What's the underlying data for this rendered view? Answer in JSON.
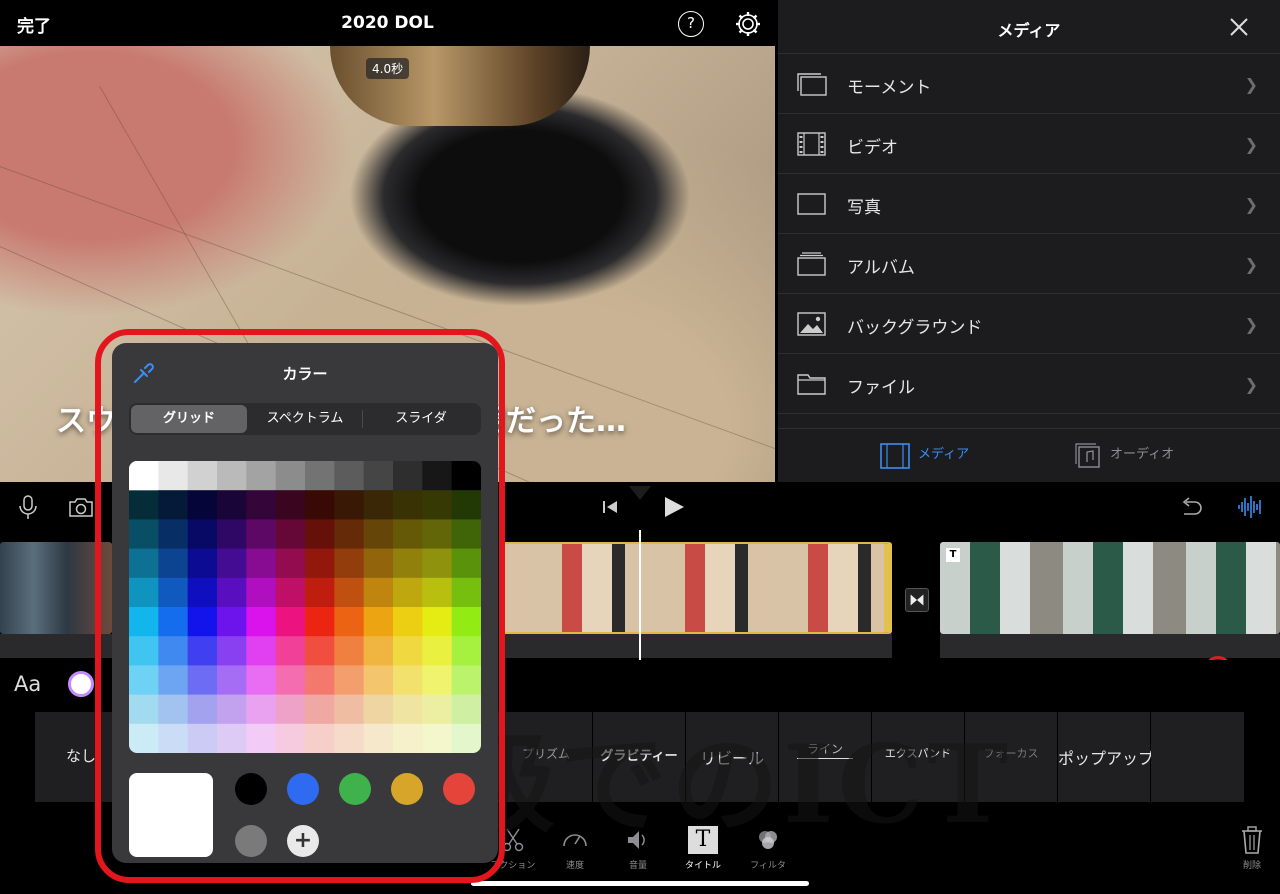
{
  "topbar": {
    "done_label": "完了",
    "project_title": "2020 DOL",
    "help_label": "?"
  },
  "preview": {
    "duration": "4.0秒",
    "caption": "スウ　　　　　　　　　　北極圏だった…"
  },
  "media_panel": {
    "title": "メディア",
    "items": [
      {
        "label": "モーメント",
        "icon": "moments-icon"
      },
      {
        "label": "ビデオ",
        "icon": "film-icon"
      },
      {
        "label": "写真",
        "icon": "photo-frame-icon"
      },
      {
        "label": "アルバム",
        "icon": "album-icon"
      },
      {
        "label": "バックグラウンド",
        "icon": "background-icon"
      },
      {
        "label": "ファイル",
        "icon": "folder-icon"
      }
    ],
    "tabs": [
      {
        "label": "メディア",
        "active": true
      },
      {
        "label": "オーディオ",
        "active": false
      }
    ]
  },
  "title_styles": {
    "font_label": "Aa",
    "tiles": [
      "なし",
      "",
      "",
      "",
      "",
      "プリズム",
      "グラビティー",
      "リビール",
      "ライン",
      "エクスパンド",
      "フォーカス",
      "ポップアップ",
      ""
    ]
  },
  "bottom_tools": [
    {
      "label": "アクション",
      "icon": "scissors-icon"
    },
    {
      "label": "速度",
      "icon": "speedometer-icon"
    },
    {
      "label": "音量",
      "icon": "speaker-icon"
    },
    {
      "label": "タイトル",
      "icon": "title-icon",
      "active": true
    },
    {
      "label": "フィルタ",
      "icon": "filter-icon"
    },
    {
      "label": "削除",
      "icon": "trash-icon"
    }
  ],
  "watermark": "学級でのICT",
  "color_popover": {
    "title": "カラー",
    "segments": [
      "グリッド",
      "スペクトラム",
      "スライダ"
    ],
    "active_segment": "グリッド",
    "current_color": "#ffffff",
    "recent_swatches": [
      "#000000",
      "#2f6bf0",
      "#3fb24c",
      "#d7a52a",
      "#e4443a",
      "#7a7a7a"
    ],
    "add_label": "+"
  },
  "colors": {
    "accent": "#3a8ef5",
    "highlight_frame": "#e3161e",
    "clip_border": "#e3b64b"
  }
}
